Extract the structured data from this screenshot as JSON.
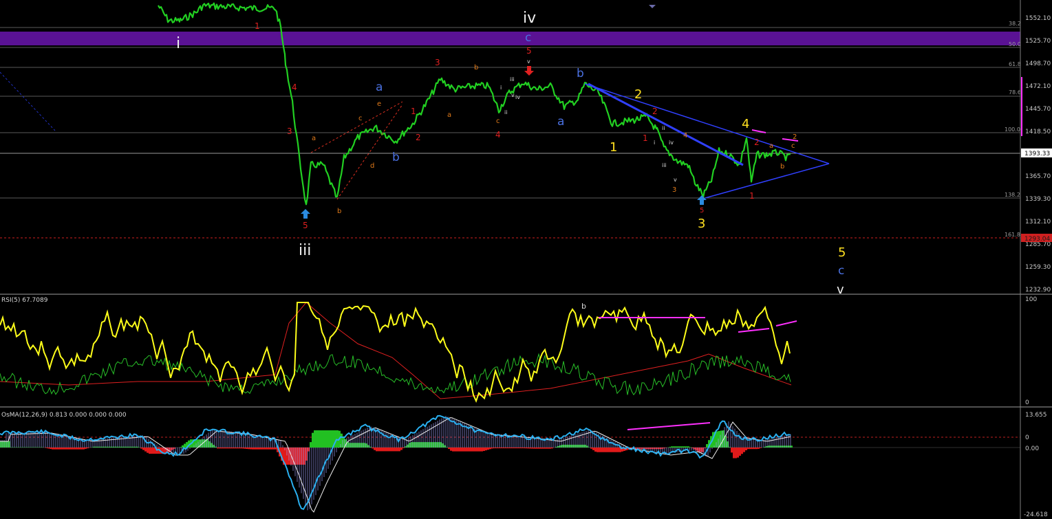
{
  "price_axis": [
    "1552.10",
    "1525.70",
    "1498.70",
    "1472.10",
    "1445.70",
    "1418.50",
    "1393.33",
    "1365.70",
    "1339.30",
    "1312.10",
    "1285.70",
    "1259.30",
    "1232.90"
  ],
  "price_marker": {
    "current": "1393.33",
    "target": "1293.04"
  },
  "fib_levels": [
    "38.2",
    "50.0",
    "61.8",
    "78.6",
    "100.0",
    "138.2",
    "161.8"
  ],
  "rsi": {
    "title": "RSI(5) 67.7089",
    "max": "100",
    "min": "0"
  },
  "osma": {
    "title": "OsMA(12,26,9) 0.813 0.000 0.000 0.000",
    "max": "13.655",
    "zero": "0",
    "zero2": "0.00",
    "min": "-24.618"
  },
  "labels": {
    "i": "i",
    "iii": "iii",
    "iv": "iv",
    "iv_c": "c",
    "iv_5": "5",
    "iv_v": "v",
    "a1": "a",
    "b1": "b",
    "a2": "a",
    "b2": "b",
    "b3": "b",
    "n1": "1",
    "n2": "2",
    "n3": "3",
    "n4": "4",
    "n5": "5",
    "c_end": "c",
    "v_end": "v",
    "r1_top": "1",
    "r3": "3",
    "r4": "4",
    "r3b": "3",
    "r5": "5",
    "r1a": "1",
    "r2a": "2",
    "r4b": "4",
    "r1b": "1",
    "r2b": "2",
    "r4c": "4",
    "r3c": "3",
    "r5b": "5",
    "r2c": "2",
    "r1c": "1",
    "r2d": "2",
    "o_a": "a",
    "o_b": "b",
    "o_c": "c",
    "o_d": "d",
    "o_e": "e",
    "o_a2": "a",
    "o_b2": "b",
    "o_c2": "c",
    "o_a3": "a",
    "o_b3": "b",
    "o_c3": "c",
    "w_i": "i",
    "w_ii": "ii",
    "w_iii": "iii",
    "w_iv": "iv",
    "w_v": "v",
    "w_i2": "i",
    "w_ii2": "ii",
    "w_iii2": "iii",
    "w_iv2": "iv",
    "w_v2": "v",
    "w_i3": "i",
    "w_iv3": "iv",
    "rsi_b": "b"
  },
  "colors": {
    "candle": "#22d022",
    "rsi": "#ffff1a",
    "rsi_red": "#e02020",
    "rsi_green": "#28c028",
    "osma_line": "#2ab0f0",
    "trend": "#3040ff",
    "pink": "#ff30ff",
    "band": "#5a1294"
  }
}
